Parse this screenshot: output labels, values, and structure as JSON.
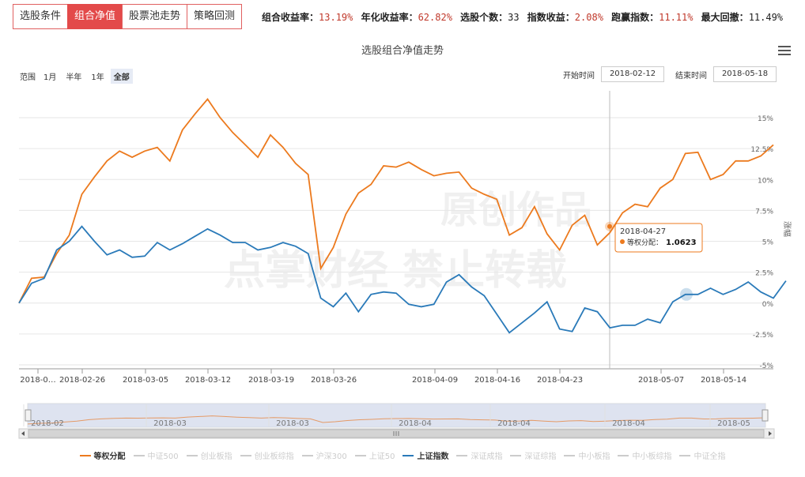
{
  "tabs": [
    {
      "label": "选股条件",
      "active": false
    },
    {
      "label": "组合净值",
      "active": true
    },
    {
      "label": "股票池走势",
      "active": false
    },
    {
      "label": "策略回测",
      "active": false
    }
  ],
  "stats": [
    {
      "label": "组合收益率：",
      "value": "13.19%",
      "color": "red"
    },
    {
      "label": "年化收益率：",
      "value": "62.82%",
      "color": "red"
    },
    {
      "label": "选股个数：",
      "value": "33",
      "color": "plain"
    },
    {
      "label": "指数收益：",
      "value": "2.08%",
      "color": "red"
    },
    {
      "label": "跑赢指数：",
      "value": "11.11%",
      "color": "red"
    },
    {
      "label": "最大回撤：",
      "value": "11.49%",
      "color": "plain"
    }
  ],
  "range_selector": {
    "label": "范围",
    "buttons": [
      "1月",
      "半年",
      "1年",
      "全部"
    ],
    "selected": "全部"
  },
  "date_inputs": {
    "start_label": "开始时间",
    "start": "2018-02-12",
    "end_label": "结束时间",
    "end": "2018-05-18"
  },
  "watermark": {
    "line1": "原创作品",
    "line2": "点掌财经 禁止转载"
  },
  "tooltip": {
    "date": "2018-04-27",
    "series": "等权分配：",
    "value": "1.0623"
  },
  "navigator_labels": [
    "2018-02",
    "2018-03",
    "2018-03",
    "2018-04",
    "2018-04",
    "2018-04",
    "2018-05"
  ],
  "legend": [
    {
      "name": "等权分配",
      "on": true,
      "color": "#ec7a1e"
    },
    {
      "name": "中证500",
      "on": false
    },
    {
      "name": "创业板指",
      "on": false
    },
    {
      "name": "创业板综指",
      "on": false
    },
    {
      "name": "沪深300",
      "on": false
    },
    {
      "name": "上证50",
      "on": false
    },
    {
      "name": "上证指数",
      "on": true,
      "color": "#2a7ab9"
    },
    {
      "name": "深证成指",
      "on": false
    },
    {
      "name": "深证综指",
      "on": false
    },
    {
      "name": "中小板指",
      "on": false
    },
    {
      "name": "中小板综指",
      "on": false
    },
    {
      "name": "中证全指",
      "on": false
    }
  ],
  "chart_data": {
    "type": "line",
    "title": "选股组合净值走势",
    "ylabel": "涨幅",
    "ylim": [
      -5,
      17.5
    ],
    "y_ticks": [
      "-5%",
      "-2.5%",
      "0%",
      "2.5%",
      "5%",
      "7.5%",
      "10%",
      "12.5%",
      "15%"
    ],
    "x_tick_labels": [
      "2018-0…",
      "2018-02-26",
      "2018-03-05",
      "2018-03-12",
      "2018-03-19",
      "2018-03-26",
      "2018-04-09",
      "2018-04-16",
      "2018-04-23",
      "2018-05-07",
      "2018-05-14"
    ],
    "grid": true,
    "legend_position": "bottom",
    "series": [
      {
        "name": "等权分配",
        "color": "#ec7a1e",
        "values": [
          0.0,
          2.0,
          2.1,
          4.0,
          5.5,
          8.8,
          10.2,
          11.5,
          12.3,
          11.8,
          12.3,
          12.6,
          11.5,
          14.0,
          15.3,
          16.5,
          15.0,
          13.8,
          12.8,
          11.8,
          13.6,
          12.6,
          11.3,
          10.4,
          2.8,
          4.5,
          7.2,
          8.9,
          9.6,
          11.1,
          11.0,
          11.4,
          10.8,
          10.3,
          10.5,
          10.6,
          9.3,
          8.8,
          8.4,
          5.5,
          6.1,
          7.8,
          5.6,
          4.3,
          6.3,
          7.1,
          4.7,
          5.7,
          7.3,
          8.0,
          7.8,
          9.3,
          10.0,
          12.1,
          12.2,
          10.0,
          10.4,
          11.5,
          11.5,
          11.9,
          12.8
        ]
      },
      {
        "name": "上证指数",
        "color": "#2a7ab9",
        "values": [
          0.0,
          1.6,
          2.0,
          4.3,
          5.0,
          6.2,
          5.0,
          3.9,
          4.3,
          3.7,
          3.8,
          4.9,
          4.3,
          4.8,
          5.4,
          6.0,
          5.5,
          4.9,
          4.9,
          4.3,
          4.5,
          4.9,
          4.6,
          4.0,
          0.4,
          -0.3,
          0.8,
          -0.7,
          0.7,
          0.9,
          0.8,
          -0.1,
          -0.3,
          -0.1,
          1.7,
          2.3,
          1.3,
          0.6,
          -0.9,
          -2.4,
          -1.6,
          -0.8,
          0.1,
          -2.1,
          -2.3,
          -0.4,
          -0.7,
          -2.0,
          -1.8,
          -1.8,
          -1.3,
          -1.6,
          0.1,
          0.7,
          0.7,
          1.2,
          0.7,
          1.1,
          1.7,
          0.9,
          0.4,
          1.8
        ]
      }
    ],
    "navigator": {
      "values": [
        0.0,
        1.5,
        2.1,
        4.0,
        6.0,
        8.8,
        10.4,
        11.5,
        12.0,
        11.9,
        12.2,
        12.5,
        12.0,
        14.2,
        15.3,
        16.5,
        15.2,
        13.9,
        13.0,
        12.0,
        13.0,
        12.5,
        11.3,
        10.5,
        3.0,
        4.6,
        7.0,
        8.6,
        9.4,
        10.8,
        11.0,
        11.2,
        10.6,
        10.1,
        10.3,
        10.5,
        9.0,
        8.5,
        8.0,
        5.8,
        6.1,
        7.3,
        5.8,
        4.6,
        6.2,
        6.9,
        5.0,
        5.7,
        7.0,
        7.7,
        7.6,
        9.0,
        10.0,
        12.0,
        12.1,
        10.2,
        10.5,
        11.4,
        11.5,
        11.9,
        12.6
      ]
    }
  }
}
